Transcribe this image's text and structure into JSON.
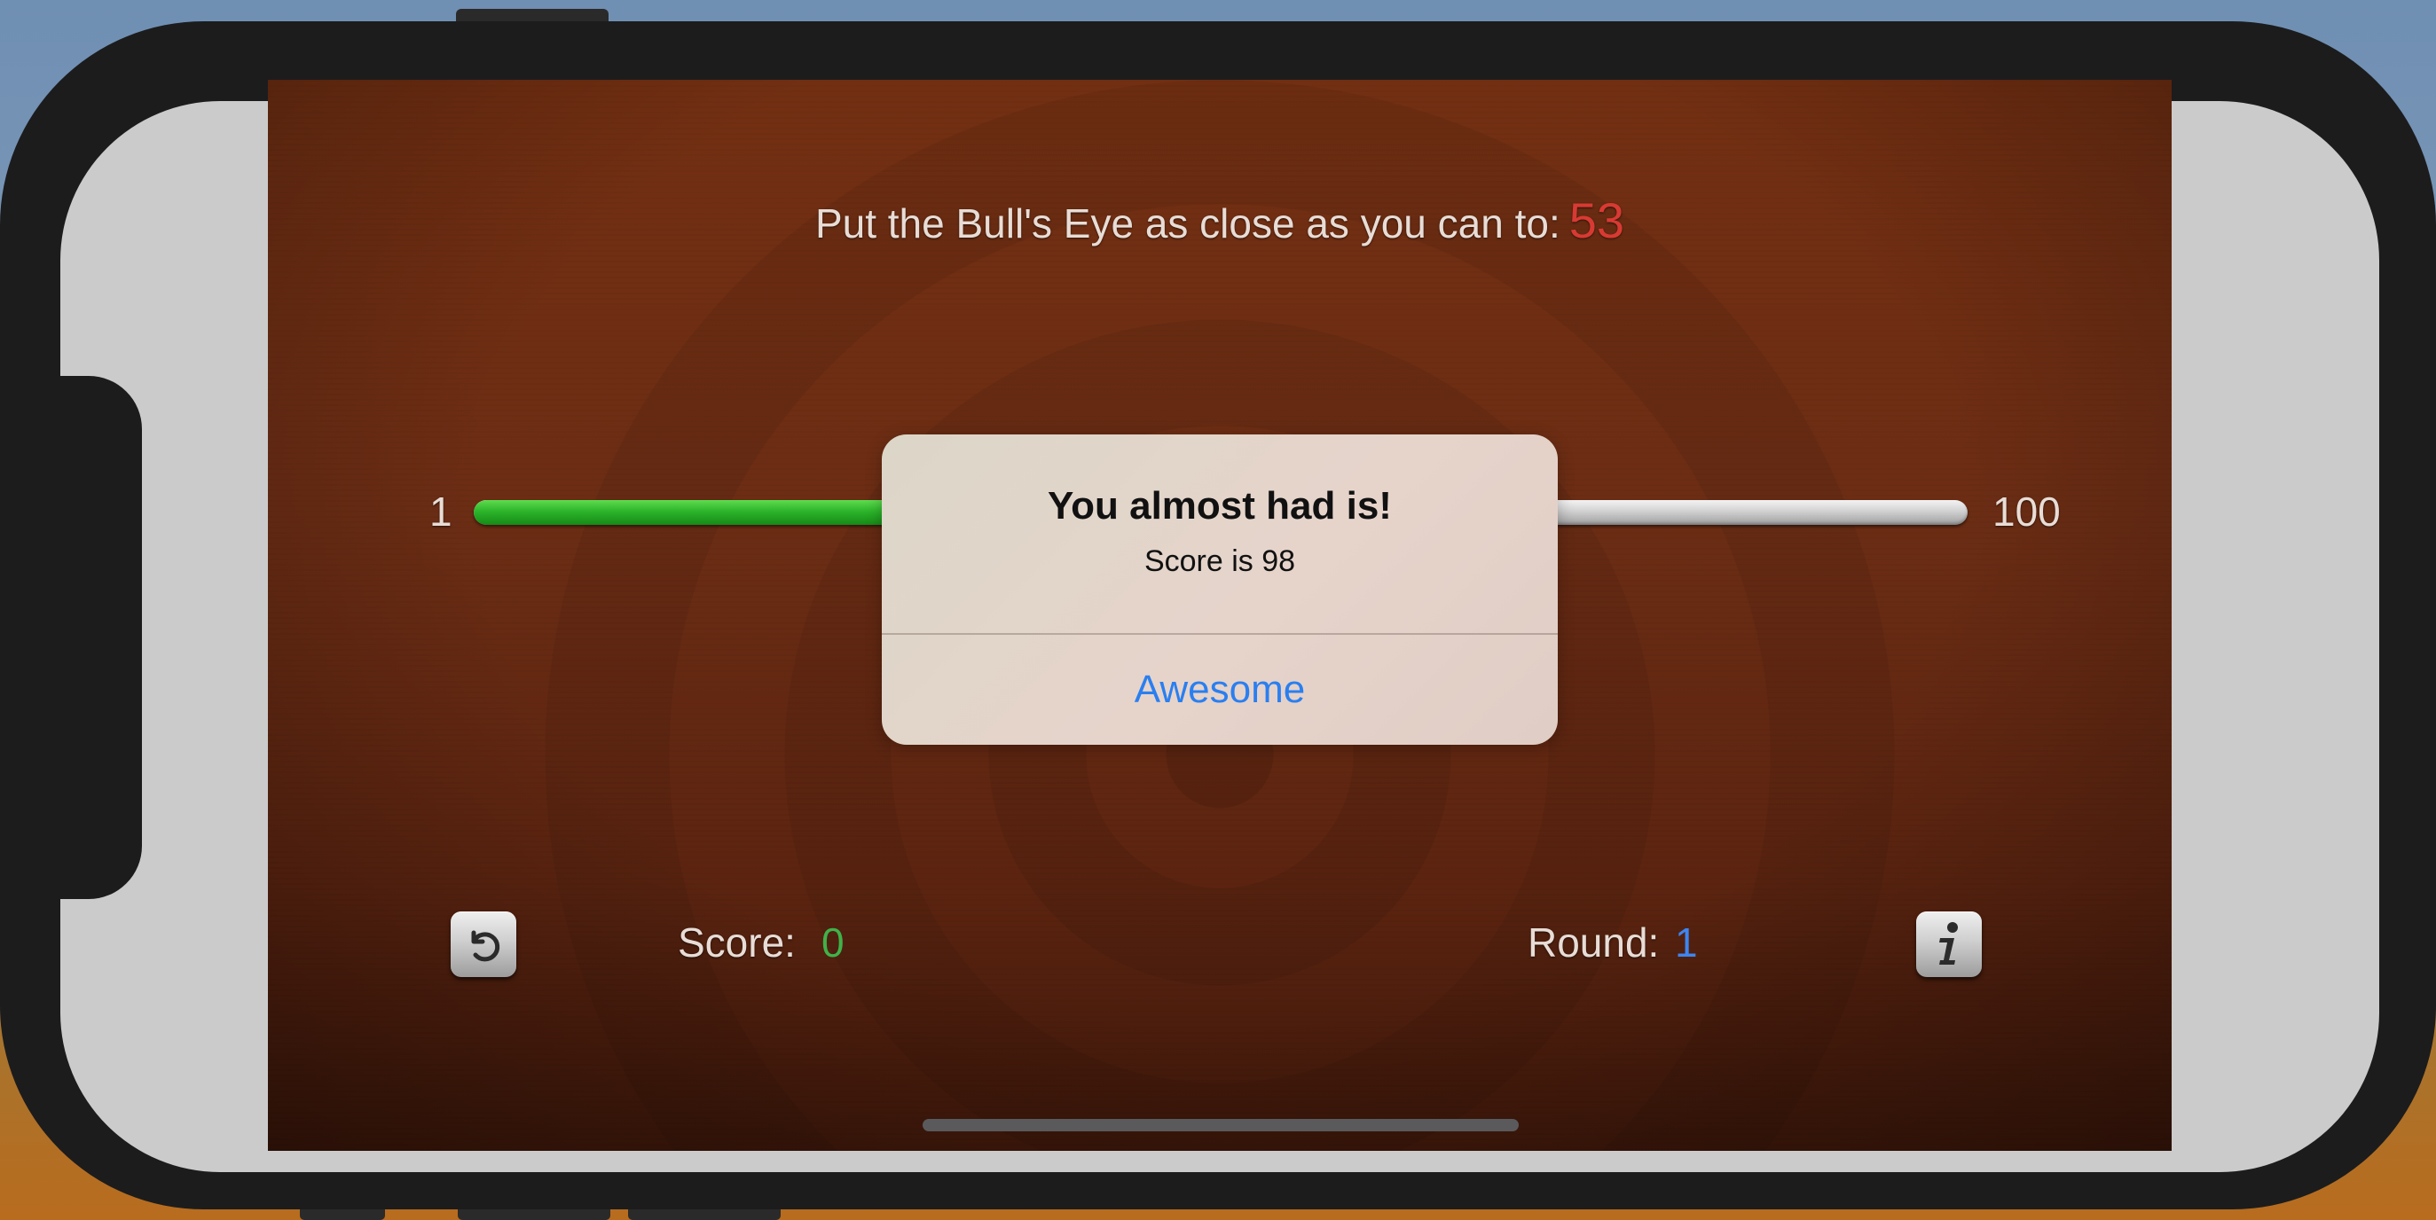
{
  "game": {
    "prompt": "Put the Bull's Eye as close as you can to:",
    "target": "53",
    "slider": {
      "min_label": "1",
      "max_label": "100",
      "value_fraction": 0.53
    },
    "score_label": "Score:",
    "score_value": "0",
    "round_label": "Round:",
    "round_value": "1"
  },
  "alert": {
    "title": "You almost had is!",
    "message": "Score is 98",
    "button_label": "Awesome"
  },
  "icons": {
    "restart": "restart-icon",
    "info": "info-icon"
  },
  "colors": {
    "target_value": "#d83a33",
    "score_value": "#3fb24a",
    "round_value": "#3d86f2",
    "alert_button": "#2a7ff0",
    "slider_fill": "#2db52b"
  }
}
